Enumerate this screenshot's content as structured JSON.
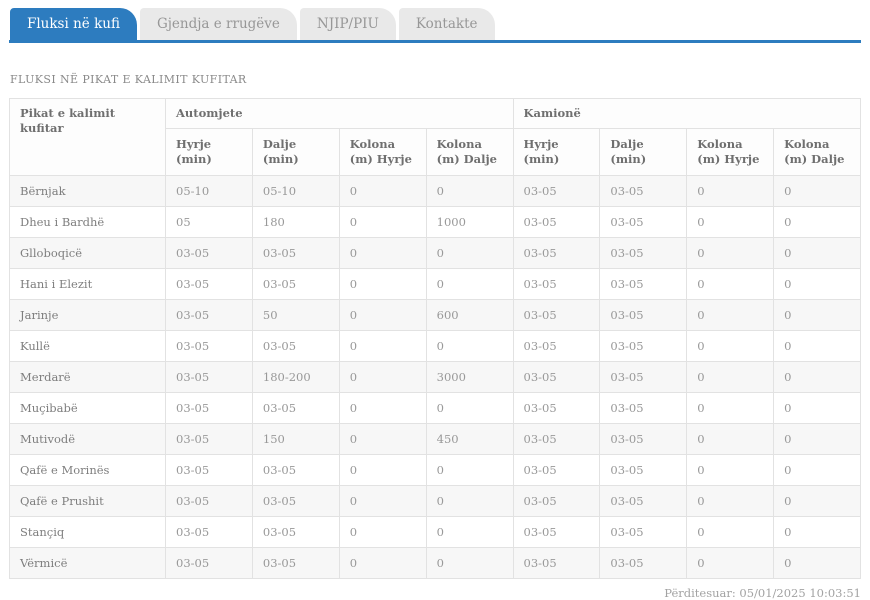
{
  "tabs": [
    {
      "label": "Fluksi në kufi",
      "active": true
    },
    {
      "label": "Gjendja e rrugëve",
      "active": false
    },
    {
      "label": "NJIP/PIU",
      "active": false
    },
    {
      "label": "Kontakte",
      "active": false
    }
  ],
  "page_title": "FLUKSI NË PIKAT E KALIMIT KUFITAR",
  "table": {
    "corner_header": "Pikat e kalimit kufitar",
    "groups": [
      {
        "label": "Automjete"
      },
      {
        "label": "Kamionë"
      }
    ],
    "sub_headers": [
      "Hyrje (min)",
      "Dalje (min)",
      "Kolona (m) Hyrje",
      "Kolona (m) Dalje"
    ],
    "rows": [
      {
        "name": "Bërnjak",
        "values": [
          "05-10",
          "05-10",
          "0",
          "0",
          "03-05",
          "03-05",
          "0",
          "0"
        ]
      },
      {
        "name": "Dheu i Bardhë",
        "values": [
          "05",
          "180",
          "0",
          "1000",
          "03-05",
          "03-05",
          "0",
          "0"
        ]
      },
      {
        "name": "Glloboqicë",
        "values": [
          "03-05",
          "03-05",
          "0",
          "0",
          "03-05",
          "03-05",
          "0",
          "0"
        ]
      },
      {
        "name": "Hani i Elezit",
        "values": [
          "03-05",
          "03-05",
          "0",
          "0",
          "03-05",
          "03-05",
          "0",
          "0"
        ]
      },
      {
        "name": "Jarinje",
        "values": [
          "03-05",
          "50",
          "0",
          "600",
          "03-05",
          "03-05",
          "0",
          "0"
        ]
      },
      {
        "name": "Kullë",
        "values": [
          "03-05",
          "03-05",
          "0",
          "0",
          "03-05",
          "03-05",
          "0",
          "0"
        ]
      },
      {
        "name": "Merdarë",
        "values": [
          "03-05",
          "180-200",
          "0",
          "3000",
          "03-05",
          "03-05",
          "0",
          "0"
        ]
      },
      {
        "name": "Muçibabë",
        "values": [
          "03-05",
          "03-05",
          "0",
          "0",
          "03-05",
          "03-05",
          "0",
          "0"
        ]
      },
      {
        "name": "Mutivodë",
        "values": [
          "03-05",
          "150",
          "0",
          "450",
          "03-05",
          "03-05",
          "0",
          "0"
        ]
      },
      {
        "name": "Qafë e Morinës",
        "values": [
          "03-05",
          "03-05",
          "0",
          "0",
          "03-05",
          "03-05",
          "0",
          "0"
        ]
      },
      {
        "name": "Qafë e Prushit",
        "values": [
          "03-05",
          "03-05",
          "0",
          "0",
          "03-05",
          "03-05",
          "0",
          "0"
        ]
      },
      {
        "name": "Stançiq",
        "values": [
          "03-05",
          "03-05",
          "0",
          "0",
          "03-05",
          "03-05",
          "0",
          "0"
        ]
      },
      {
        "name": "Vërmicë",
        "values": [
          "03-05",
          "03-05",
          "0",
          "0",
          "03-05",
          "03-05",
          "0",
          "0"
        ]
      }
    ]
  },
  "footer": {
    "updated_label": "Përditesuar: 05/01/2025 10:03:51"
  },
  "colors": {
    "accent_blue": "#2d7cbf",
    "inactive_tab_bg": "#e9e9e9",
    "table_border": "#e2e2e2",
    "stripe_row_bg": "#f7f7f7"
  }
}
